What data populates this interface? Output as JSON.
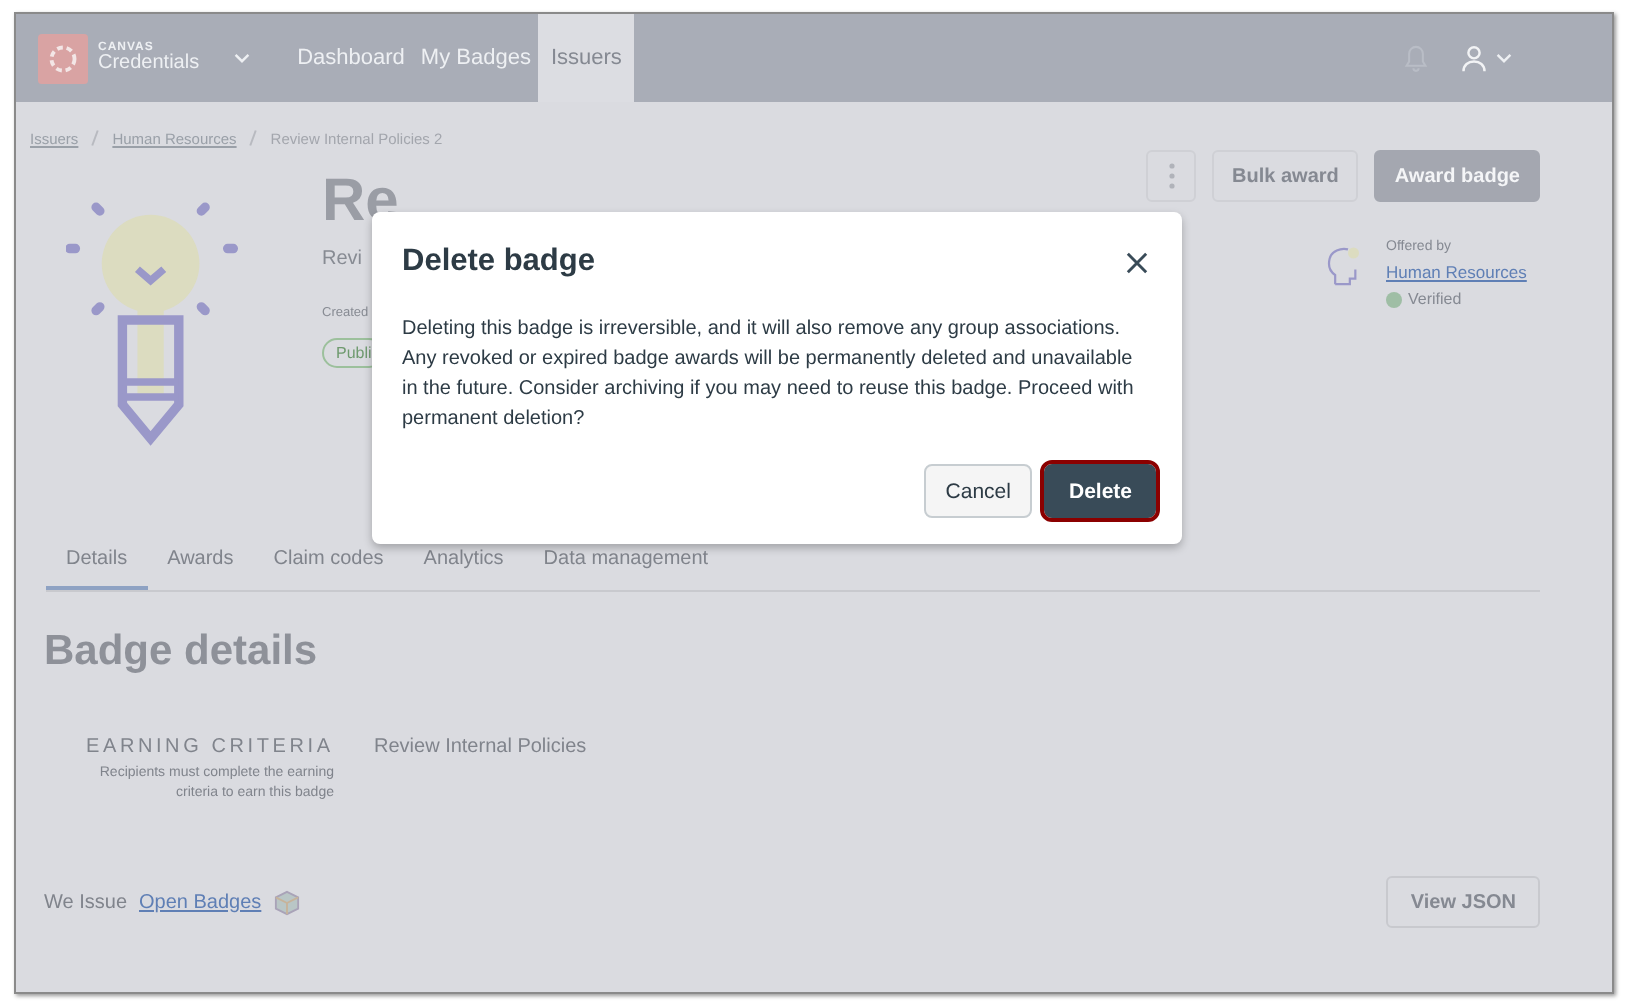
{
  "nav": {
    "logo_top": "CANVAS",
    "logo_bottom": "Credentials",
    "links": [
      {
        "label": "Dashboard",
        "selected": false
      },
      {
        "label": "My Badges",
        "selected": false
      },
      {
        "label": "Issuers",
        "selected": true
      }
    ]
  },
  "breadcrumb": [
    {
      "label": "Issuers",
      "kind": "link"
    },
    {
      "label": "Human Resources",
      "kind": "link"
    },
    {
      "label": "Review Internal Policies 2",
      "kind": "current"
    }
  ],
  "badge": {
    "title": "Re",
    "subtitle": "Revi",
    "created": "Created",
    "status": "Publi",
    "actions": [
      "Bulk award",
      "Award badge"
    ],
    "offered_by_label": "Offered by",
    "issuer": "Human Resources",
    "verified": "Verified"
  },
  "tabs": [
    {
      "label": "Details",
      "selected": true
    },
    {
      "label": "Awards",
      "selected": false
    },
    {
      "label": "Claim codes",
      "selected": false
    },
    {
      "label": "Analytics",
      "selected": false
    },
    {
      "label": "Data management",
      "selected": false
    }
  ],
  "details": {
    "heading": "Badge details",
    "criteria_label": "EARNING CRITERIA",
    "criteria_hint": "Recipients must complete the earning criteria to earn this badge",
    "criteria_value": "Review Internal Policies"
  },
  "footer": {
    "we_issue": "We Issue",
    "open_badges": "Open Badges",
    "view_json": "View JSON"
  },
  "dialog": {
    "title": "Delete badge",
    "body": "Deleting this badge is irreversible, and it will also remove any group associations. Any revoked or expired badge awards will be permanently deleted and unavailable in the future. Consider archiving if you may need to reuse this badge. Proceed with permanent deletion?",
    "buttons": [
      {
        "label": "Cancel",
        "kind": "secondary"
      },
      {
        "label": "Delete",
        "kind": "danger"
      }
    ]
  }
}
